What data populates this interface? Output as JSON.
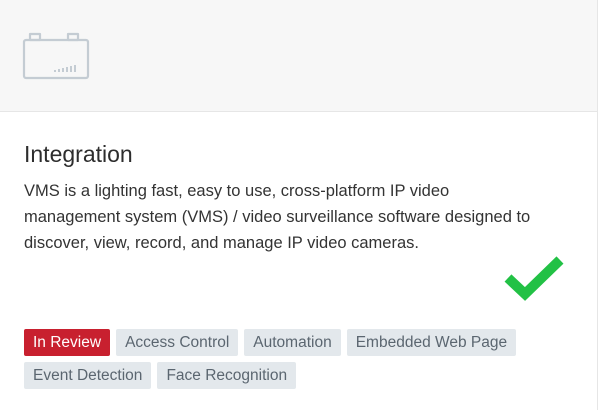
{
  "header": {
    "icon": "battery-signal-icon"
  },
  "card": {
    "title": "Integration",
    "description": "VMS is a lighting fast, easy to use, cross-platform IP video management system (VMS) / video surveillance software designed to discover, view, record, and manage IP video cameras.",
    "verified_icon": "checkmark-icon"
  },
  "status_badge": {
    "label": "In Review",
    "color": "#c8202f"
  },
  "tags": [
    "Access Control",
    "Automation",
    "Embedded Web Page",
    "Event Detection",
    "Face Recognition"
  ],
  "colors": {
    "check": "#22c145",
    "tag_bg": "#e3e8ec",
    "header_bg": "#f7f7f7"
  }
}
